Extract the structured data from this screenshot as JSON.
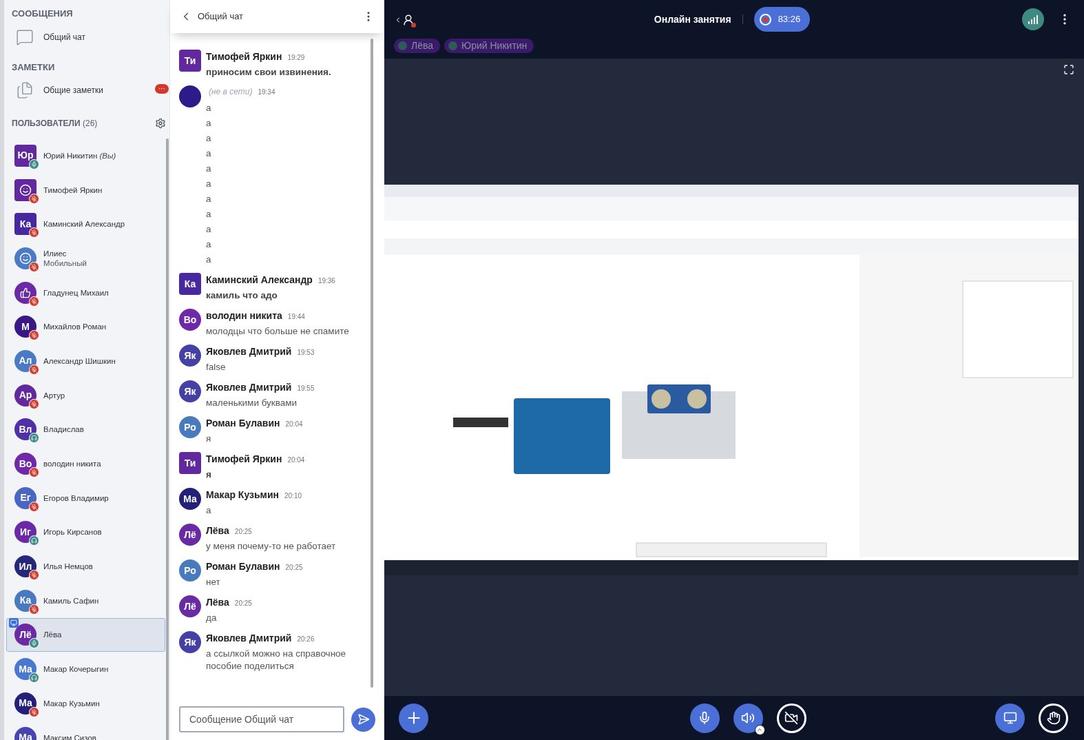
{
  "sidebar": {
    "messages_header": "СООБЩЕНИЯ",
    "chat_item": "Общий чат",
    "notes_header": "ЗАМЕТКИ",
    "notes_item": "Общие заметки",
    "notes_badge": "···",
    "users_header": "ПОЛЬЗОВАТЕЛИ",
    "users_count": "(26)",
    "users": [
      {
        "name": "Юрий Никитин",
        "suffix": "(Вы)",
        "avatar": {
          "kind": "initials",
          "text": "Юр",
          "color": "#62289e",
          "square": true
        },
        "muted": false,
        "listen_only": false,
        "selected": false,
        "presenter": false
      },
      {
        "name": "Тимофей Яркин",
        "avatar": {
          "kind": "smile",
          "color": "#62289e",
          "square": true
        },
        "muted": true,
        "listen_only": false,
        "selected": false,
        "presenter": false
      },
      {
        "name": "Каминский Александр",
        "avatar": {
          "kind": "initials",
          "text": "Ка",
          "color": "#48289e",
          "square": true
        },
        "muted": true,
        "listen_only": false,
        "selected": false,
        "presenter": false
      },
      {
        "name": "Илиес",
        "subtitle": "Мобильный",
        "avatar": {
          "kind": "smile",
          "color": "#4a7cc6",
          "square": false
        },
        "muted": true,
        "listen_only": false,
        "selected": false,
        "presenter": false
      },
      {
        "name": "Гладунец Михаил",
        "avatar": {
          "kind": "thumb",
          "color": "#6a2aa6",
          "square": false
        },
        "muted": true,
        "listen_only": false,
        "selected": false,
        "presenter": false
      },
      {
        "name": "Михайлов Роман",
        "avatar": {
          "kind": "initials",
          "text": "М",
          "color": "#3a1884",
          "square": false
        },
        "muted": true,
        "listen_only": false,
        "selected": false,
        "presenter": false
      },
      {
        "name": "Александр Шишкин",
        "avatar": {
          "kind": "initials",
          "text": "Ал",
          "color": "#4a7ac4",
          "square": false
        },
        "muted": true,
        "listen_only": false,
        "selected": false,
        "presenter": false
      },
      {
        "name": "Артур",
        "avatar": {
          "kind": "initials",
          "text": "Ар",
          "color": "#62289e",
          "square": false
        },
        "muted": true,
        "listen_only": false,
        "selected": false,
        "presenter": false
      },
      {
        "name": "Владислав",
        "avatar": {
          "kind": "initials",
          "text": "Вл",
          "color": "#5030a6",
          "square": false
        },
        "listen_only": true,
        "selected": false,
        "presenter": false
      },
      {
        "name": "володин никита",
        "avatar": {
          "kind": "initials",
          "text": "Во",
          "color": "#6e28a8",
          "square": false
        },
        "muted": true,
        "listen_only": false,
        "selected": false,
        "presenter": false
      },
      {
        "name": "Егоров Владимир",
        "avatar": {
          "kind": "initials",
          "text": "Ег",
          "color": "#4866c2",
          "square": false
        },
        "muted": true,
        "listen_only": false,
        "selected": false,
        "presenter": false
      },
      {
        "name": "Игорь Кирсанов",
        "avatar": {
          "kind": "initials",
          "text": "Иг",
          "color": "#6a2aa6",
          "square": false
        },
        "listen_only": true,
        "selected": false,
        "presenter": false
      },
      {
        "name": "Илья Немцов",
        "avatar": {
          "kind": "initials",
          "text": "Ил",
          "color": "#26277a",
          "square": false
        },
        "muted": true,
        "listen_only": false,
        "selected": false,
        "presenter": false
      },
      {
        "name": "Камиль Сафин",
        "avatar": {
          "kind": "initials",
          "text": "Ка",
          "color": "#4a7abe",
          "square": false
        },
        "muted": true,
        "listen_only": false,
        "selected": false,
        "presenter": false
      },
      {
        "name": "Лёва",
        "avatar": {
          "kind": "initials",
          "text": "Лё",
          "color": "#6a2aa6",
          "square": false
        },
        "muted": false,
        "listen_only": false,
        "selected": true,
        "presenter": true
      },
      {
        "name": "Макар Кочерыгин",
        "avatar": {
          "kind": "initials",
          "text": "Ма",
          "color": "#4a78d0",
          "square": false
        },
        "listen_only": true,
        "selected": false,
        "presenter": false
      },
      {
        "name": "Макар Кузьмин",
        "avatar": {
          "kind": "initials",
          "text": "Ма",
          "color": "#241f78",
          "square": false
        },
        "muted": true,
        "listen_only": false,
        "selected": false,
        "presenter": false
      },
      {
        "name": "Максим Сизов",
        "avatar": {
          "kind": "initials",
          "text": "Ма",
          "color": "#4646ae",
          "square": false
        },
        "selected": false,
        "presenter": false
      }
    ]
  },
  "chat": {
    "title": "Общий чат",
    "input": {
      "placeholder": "Сообщение Общий чат"
    },
    "messages": [
      {
        "author": "Тимофей Яркин",
        "time": "19:29",
        "lines": [
          "приносим свои извинения."
        ],
        "bold": true,
        "avatar": {
          "text": "Ти",
          "color": "#62289e",
          "square": true
        }
      },
      {
        "status": "(не в сети)",
        "time": "19:34",
        "lines": [
          "а",
          "а",
          "а",
          "а",
          "а",
          "а",
          "а",
          "а",
          "а",
          "а",
          "а"
        ],
        "bold": false,
        "avatar": {
          "color": "#2e1a8a",
          "square": false
        }
      },
      {
        "author": "Каминский Александр",
        "time": "19:36",
        "lines": [
          "камиль что адо"
        ],
        "bold": true,
        "avatar": {
          "text": "Ка",
          "color": "#48289e",
          "square": true
        }
      },
      {
        "author": "володин никита",
        "time": "19:44",
        "lines": [
          "молодцы что больше не спамите"
        ],
        "bold": false,
        "avatar": {
          "text": "Во",
          "color": "#6e28a8",
          "square": false
        }
      },
      {
        "author": "Яковлев Дмитрий",
        "time": "19:53",
        "lines": [
          "false"
        ],
        "bold": false,
        "avatar": {
          "text": "Як",
          "color": "#4440a6",
          "square": false
        }
      },
      {
        "author": "Яковлев Дмитрий",
        "time": "19:55",
        "lines": [
          "маленькими буквами"
        ],
        "bold": false,
        "avatar": {
          "text": "Як",
          "color": "#4440a6",
          "square": false
        }
      },
      {
        "author": "Роман Булавин",
        "time": "20:04",
        "lines": [
          "я"
        ],
        "bold": false,
        "avatar": {
          "text": "Ро",
          "color": "#4a7abe",
          "square": false
        }
      },
      {
        "author": "Тимофей Яркин",
        "time": "20:04",
        "lines": [
          "я"
        ],
        "bold": true,
        "avatar": {
          "text": "Ти",
          "color": "#62289e",
          "square": true
        }
      },
      {
        "author": "Макар Кузьмин",
        "time": "20:10",
        "lines": [
          "а"
        ],
        "bold": false,
        "avatar": {
          "text": "Ма",
          "color": "#241f78",
          "square": false
        }
      },
      {
        "author": "Лёва",
        "time": "20:25",
        "lines": [
          "у меня почему-то не работает"
        ],
        "bold": false,
        "avatar": {
          "text": "Лё",
          "color": "#6a2aa6",
          "square": false
        }
      },
      {
        "author": "Роман Булавин",
        "time": "20:25",
        "lines": [
          "нет"
        ],
        "bold": false,
        "avatar": {
          "text": "Ро",
          "color": "#4a7abe",
          "square": false
        }
      },
      {
        "author": "Лёва",
        "time": "20:25",
        "lines": [
          "да"
        ],
        "bold": false,
        "avatar": {
          "text": "Лё",
          "color": "#6a2aa6",
          "square": false
        }
      },
      {
        "author": "Яковлев Дмитрий",
        "time": "20:26",
        "lines": [
          "а ссылкой можно на справочное пособие поделиться"
        ],
        "bold": false,
        "avatar": {
          "text": "Як",
          "color": "#4440a6",
          "square": false
        }
      }
    ]
  },
  "main": {
    "title": "Онлайн занятия",
    "recording": {
      "on": true,
      "time": "83:26"
    },
    "talkers": [
      {
        "name": "Лёва"
      },
      {
        "name": "Юрий Никитин"
      }
    ],
    "controls": {
      "left": [
        {
          "kind": "add",
          "active": true
        }
      ],
      "center": [
        {
          "kind": "mic",
          "active": true
        },
        {
          "kind": "speaker",
          "active": true
        },
        {
          "kind": "camera",
          "active": false
        }
      ],
      "right": [
        {
          "kind": "screen",
          "active": true
        },
        {
          "kind": "hand",
          "active": false
        }
      ]
    }
  }
}
